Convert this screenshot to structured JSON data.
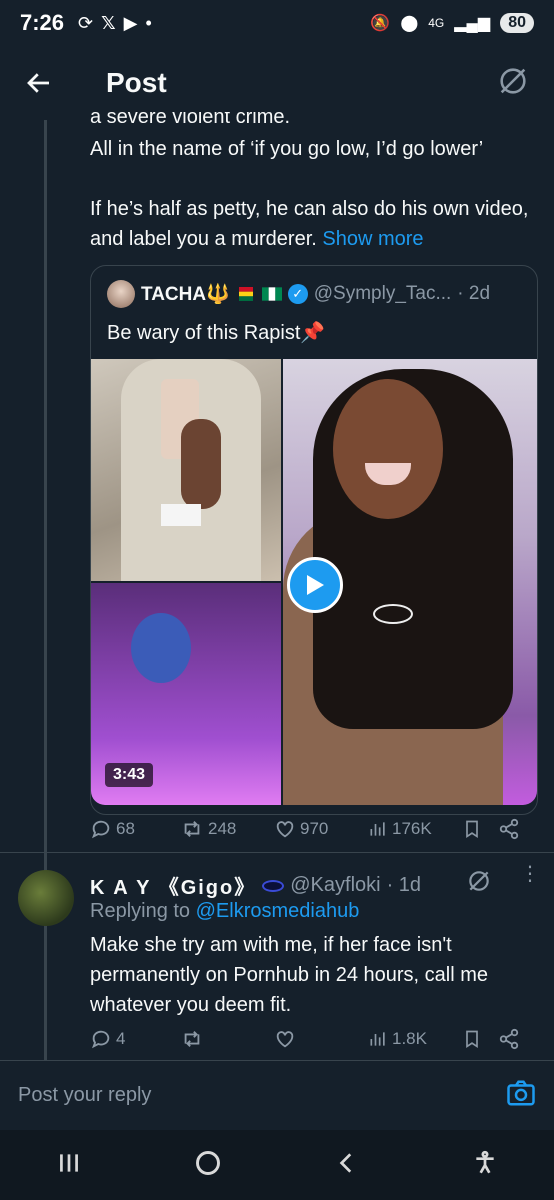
{
  "status_bar": {
    "time": "7:26",
    "network": "4G",
    "battery": "80"
  },
  "header": {
    "title": "Post"
  },
  "tweet": {
    "clipped_line": "a severe violent crime.",
    "line1": "All in the name of ‘if you go low, I’d go lower’",
    "line2": "If he’s half as petty, he can also do his own video, and label you a murderer.",
    "show_more": "Show more"
  },
  "quote": {
    "name": "TACHA🔱",
    "handle": "@Symply_Tac...",
    "time": "· 2d",
    "text": "Be wary of this Rapist📌",
    "duration": "3:43"
  },
  "tweet_actions": {
    "replies": "68",
    "reposts": "248",
    "likes": "970",
    "views": "176K"
  },
  "reply": {
    "name": "K A Y 《Gigo》",
    "handle": "@Kayfloki",
    "time": "· 1d",
    "replying_prefix": "Replying to",
    "replying_to": "@Elkrosmediahub",
    "text": "Make she try am with me, if her face isn't permanently on Pornhub in 24 hours, call me whatever you deem fit.",
    "replies": "4",
    "views": "1.8K"
  },
  "compose": {
    "placeholder": "Post your reply"
  },
  "colors": {
    "background": "#15202b",
    "accent": "#1d9bf0",
    "muted": "#8b98a5",
    "border": "#38444d"
  }
}
